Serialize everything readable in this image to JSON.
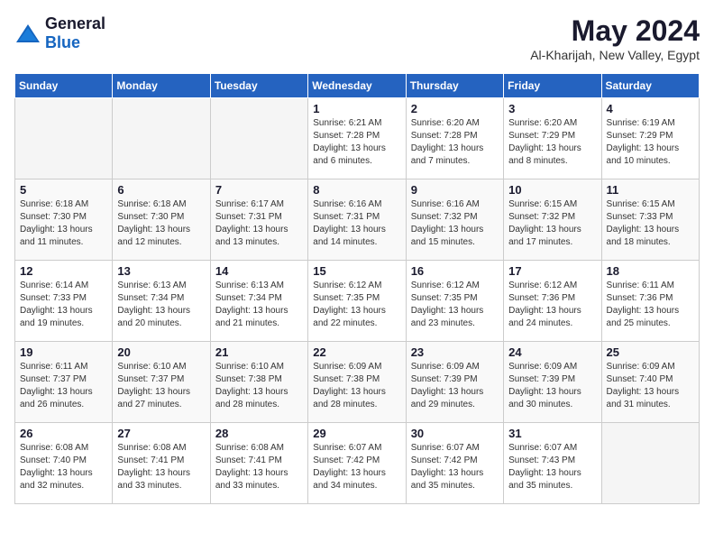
{
  "header": {
    "logo_general": "General",
    "logo_blue": "Blue",
    "month_year": "May 2024",
    "location": "Al-Kharijah, New Valley, Egypt"
  },
  "days_of_week": [
    "Sunday",
    "Monday",
    "Tuesday",
    "Wednesday",
    "Thursday",
    "Friday",
    "Saturday"
  ],
  "weeks": [
    [
      {
        "day": "",
        "info": ""
      },
      {
        "day": "",
        "info": ""
      },
      {
        "day": "",
        "info": ""
      },
      {
        "day": "1",
        "info": "Sunrise: 6:21 AM\nSunset: 7:28 PM\nDaylight: 13 hours and 6 minutes."
      },
      {
        "day": "2",
        "info": "Sunrise: 6:20 AM\nSunset: 7:28 PM\nDaylight: 13 hours and 7 minutes."
      },
      {
        "day": "3",
        "info": "Sunrise: 6:20 AM\nSunset: 7:29 PM\nDaylight: 13 hours and 8 minutes."
      },
      {
        "day": "4",
        "info": "Sunrise: 6:19 AM\nSunset: 7:29 PM\nDaylight: 13 hours and 10 minutes."
      }
    ],
    [
      {
        "day": "5",
        "info": "Sunrise: 6:18 AM\nSunset: 7:30 PM\nDaylight: 13 hours and 11 minutes."
      },
      {
        "day": "6",
        "info": "Sunrise: 6:18 AM\nSunset: 7:30 PM\nDaylight: 13 hours and 12 minutes."
      },
      {
        "day": "7",
        "info": "Sunrise: 6:17 AM\nSunset: 7:31 PM\nDaylight: 13 hours and 13 minutes."
      },
      {
        "day": "8",
        "info": "Sunrise: 6:16 AM\nSunset: 7:31 PM\nDaylight: 13 hours and 14 minutes."
      },
      {
        "day": "9",
        "info": "Sunrise: 6:16 AM\nSunset: 7:32 PM\nDaylight: 13 hours and 15 minutes."
      },
      {
        "day": "10",
        "info": "Sunrise: 6:15 AM\nSunset: 7:32 PM\nDaylight: 13 hours and 17 minutes."
      },
      {
        "day": "11",
        "info": "Sunrise: 6:15 AM\nSunset: 7:33 PM\nDaylight: 13 hours and 18 minutes."
      }
    ],
    [
      {
        "day": "12",
        "info": "Sunrise: 6:14 AM\nSunset: 7:33 PM\nDaylight: 13 hours and 19 minutes."
      },
      {
        "day": "13",
        "info": "Sunrise: 6:13 AM\nSunset: 7:34 PM\nDaylight: 13 hours and 20 minutes."
      },
      {
        "day": "14",
        "info": "Sunrise: 6:13 AM\nSunset: 7:34 PM\nDaylight: 13 hours and 21 minutes."
      },
      {
        "day": "15",
        "info": "Sunrise: 6:12 AM\nSunset: 7:35 PM\nDaylight: 13 hours and 22 minutes."
      },
      {
        "day": "16",
        "info": "Sunrise: 6:12 AM\nSunset: 7:35 PM\nDaylight: 13 hours and 23 minutes."
      },
      {
        "day": "17",
        "info": "Sunrise: 6:12 AM\nSunset: 7:36 PM\nDaylight: 13 hours and 24 minutes."
      },
      {
        "day": "18",
        "info": "Sunrise: 6:11 AM\nSunset: 7:36 PM\nDaylight: 13 hours and 25 minutes."
      }
    ],
    [
      {
        "day": "19",
        "info": "Sunrise: 6:11 AM\nSunset: 7:37 PM\nDaylight: 13 hours and 26 minutes."
      },
      {
        "day": "20",
        "info": "Sunrise: 6:10 AM\nSunset: 7:37 PM\nDaylight: 13 hours and 27 minutes."
      },
      {
        "day": "21",
        "info": "Sunrise: 6:10 AM\nSunset: 7:38 PM\nDaylight: 13 hours and 28 minutes."
      },
      {
        "day": "22",
        "info": "Sunrise: 6:09 AM\nSunset: 7:38 PM\nDaylight: 13 hours and 28 minutes."
      },
      {
        "day": "23",
        "info": "Sunrise: 6:09 AM\nSunset: 7:39 PM\nDaylight: 13 hours and 29 minutes."
      },
      {
        "day": "24",
        "info": "Sunrise: 6:09 AM\nSunset: 7:39 PM\nDaylight: 13 hours and 30 minutes."
      },
      {
        "day": "25",
        "info": "Sunrise: 6:09 AM\nSunset: 7:40 PM\nDaylight: 13 hours and 31 minutes."
      }
    ],
    [
      {
        "day": "26",
        "info": "Sunrise: 6:08 AM\nSunset: 7:40 PM\nDaylight: 13 hours and 32 minutes."
      },
      {
        "day": "27",
        "info": "Sunrise: 6:08 AM\nSunset: 7:41 PM\nDaylight: 13 hours and 33 minutes."
      },
      {
        "day": "28",
        "info": "Sunrise: 6:08 AM\nSunset: 7:41 PM\nDaylight: 13 hours and 33 minutes."
      },
      {
        "day": "29",
        "info": "Sunrise: 6:07 AM\nSunset: 7:42 PM\nDaylight: 13 hours and 34 minutes."
      },
      {
        "day": "30",
        "info": "Sunrise: 6:07 AM\nSunset: 7:42 PM\nDaylight: 13 hours and 35 minutes."
      },
      {
        "day": "31",
        "info": "Sunrise: 6:07 AM\nSunset: 7:43 PM\nDaylight: 13 hours and 35 minutes."
      },
      {
        "day": "",
        "info": ""
      }
    ]
  ]
}
